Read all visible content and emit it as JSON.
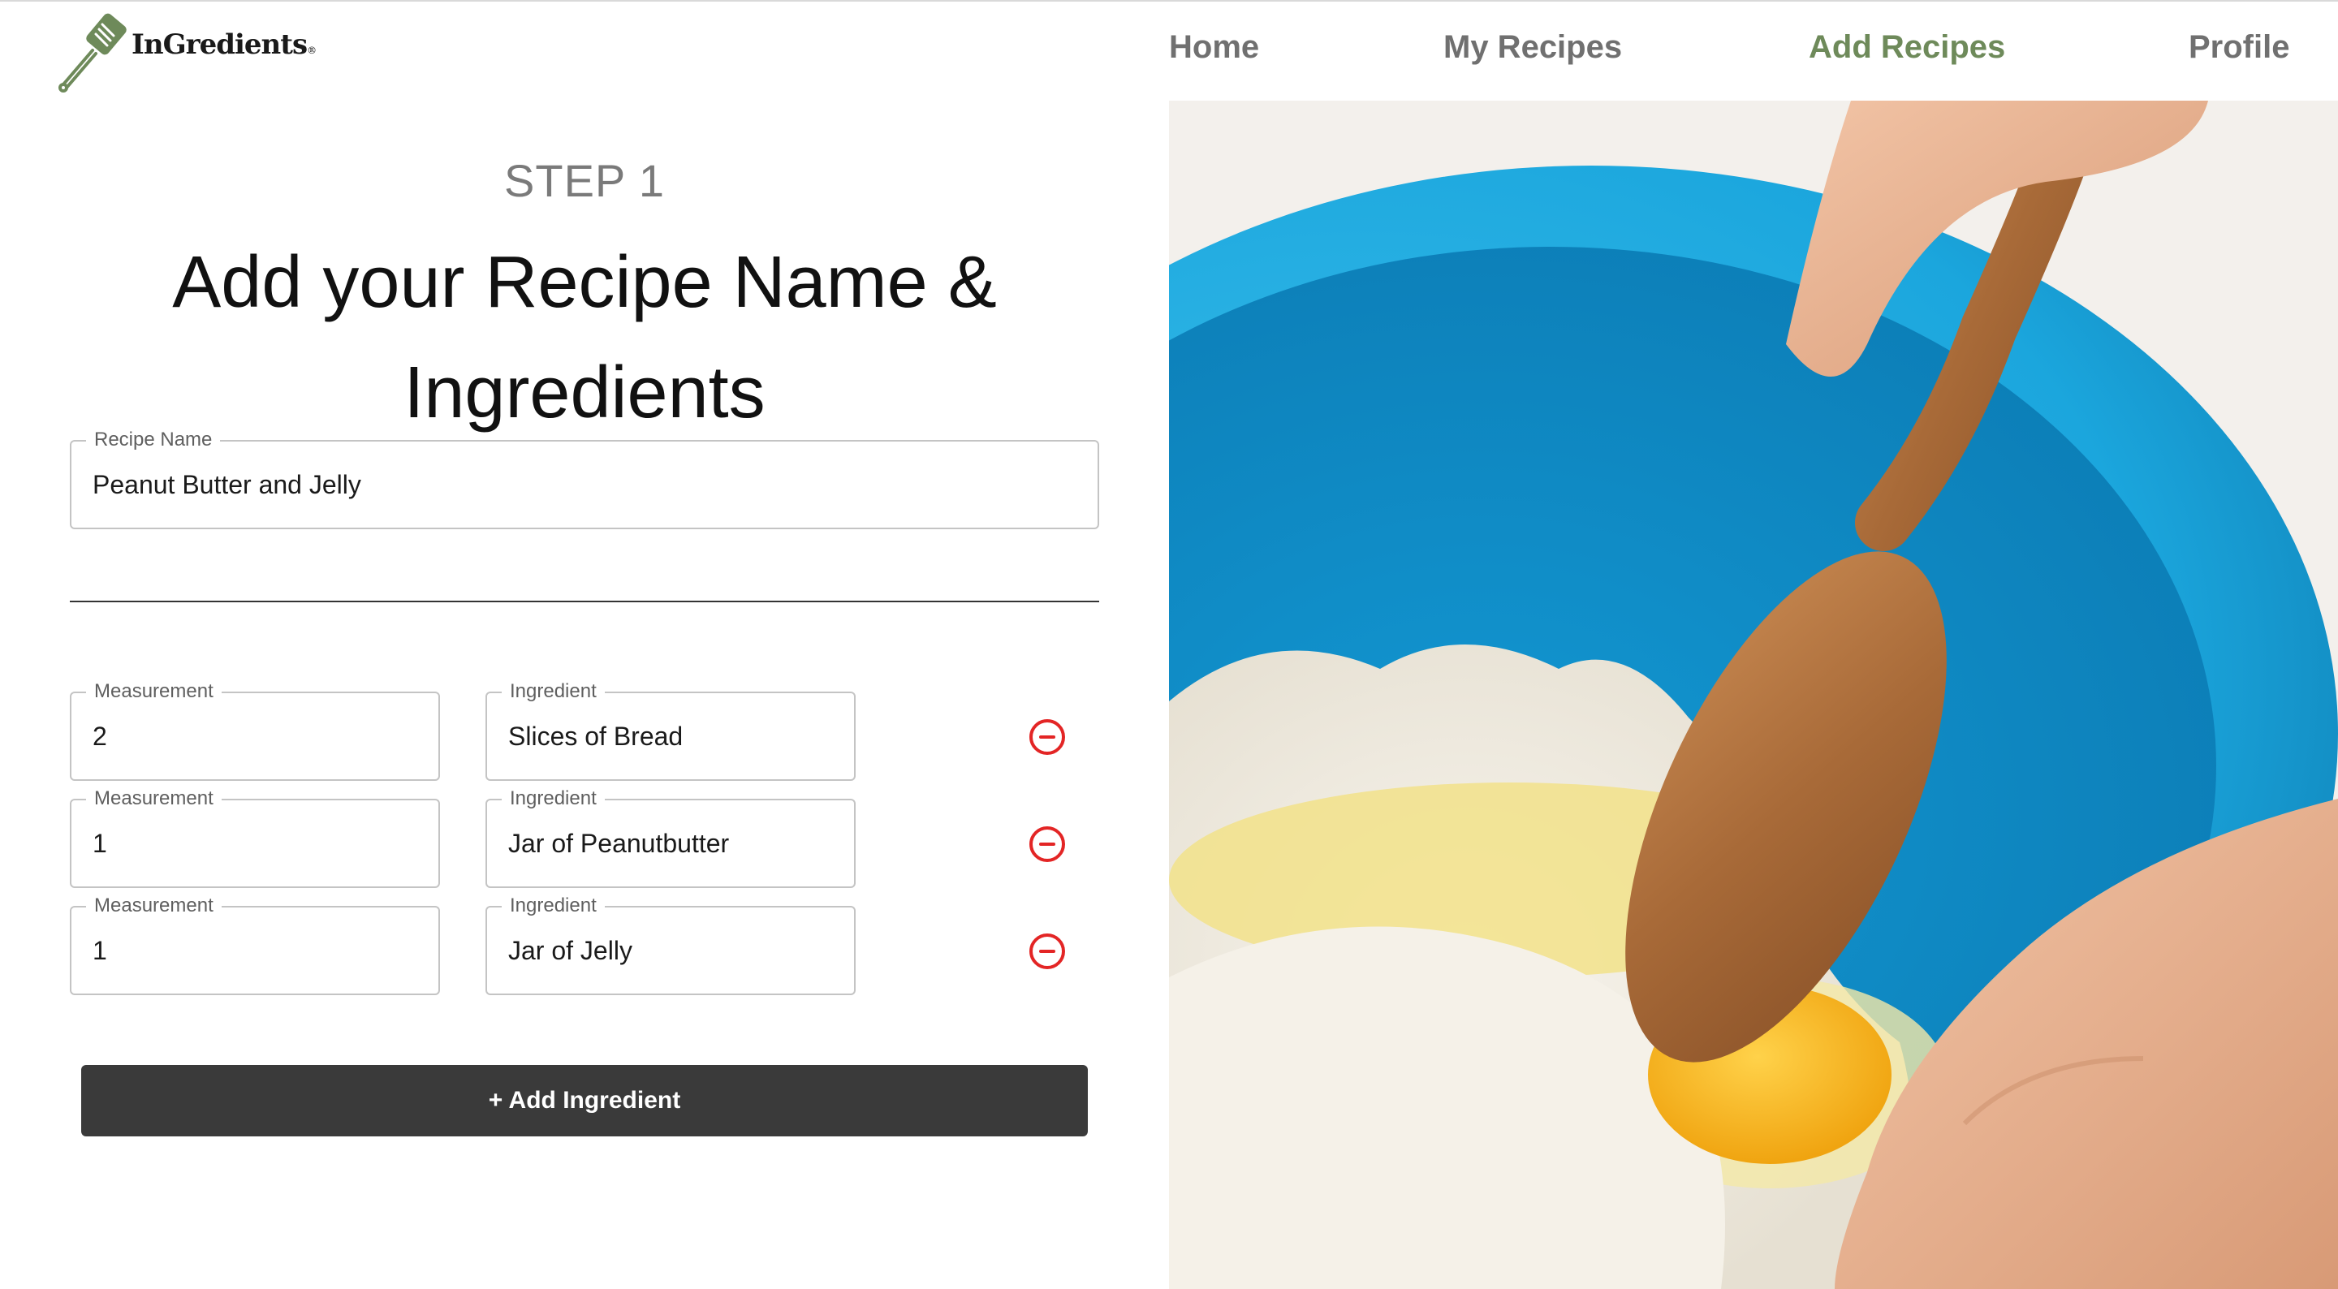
{
  "brand": {
    "name": "InGredients",
    "reg": "®"
  },
  "nav": {
    "home": "Home",
    "my_recipes": "My Recipes",
    "add_recipes": "Add Recipes",
    "profile": "Profile"
  },
  "active_nav": "Add Recipes",
  "step": "STEP 1",
  "title_line1": "Add your Recipe Name &",
  "title_line2": "Ingredients",
  "recipe": {
    "label": "Recipe Name",
    "value": "Peanut Butter and Jelly"
  },
  "ingredients": [
    {
      "measurement_label": "Measurement",
      "measurement": "2",
      "ingredient_label": "Ingredient",
      "ingredient": "Slices of Bread"
    },
    {
      "measurement_label": "Measurement",
      "measurement": "1",
      "ingredient_label": "Ingredient",
      "ingredient": "Jar of Peanutbutter"
    },
    {
      "measurement_label": "Measurement",
      "measurement": "1",
      "ingredient_label": "Ingredient",
      "ingredient": "Jar of Jelly"
    }
  ],
  "add_button": "+ Add Ingredient",
  "icons": {
    "logo": "spatula-icon",
    "remove": "remove-circle-icon"
  },
  "colors": {
    "accent": "#6e8a5a",
    "nav": "#707070",
    "remove": "#e32525",
    "button_bg": "#3a3a3a"
  }
}
